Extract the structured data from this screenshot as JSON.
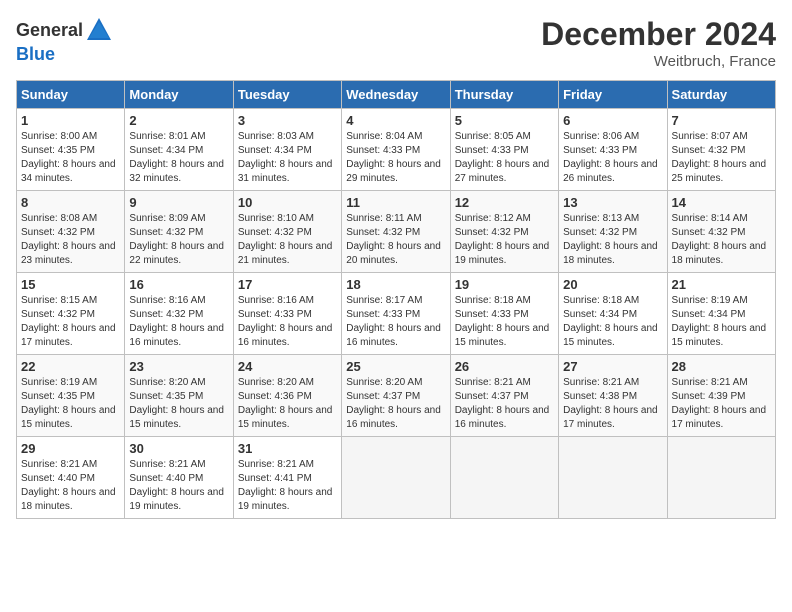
{
  "logo": {
    "general": "General",
    "blue": "Blue"
  },
  "title": "December 2024",
  "location": "Weitbruch, France",
  "days_of_week": [
    "Sunday",
    "Monday",
    "Tuesday",
    "Wednesday",
    "Thursday",
    "Friday",
    "Saturday"
  ],
  "weeks": [
    [
      {
        "day": "1",
        "sunrise": "8:00 AM",
        "sunset": "4:35 PM",
        "daylight": "8 hours and 34 minutes."
      },
      {
        "day": "2",
        "sunrise": "8:01 AM",
        "sunset": "4:34 PM",
        "daylight": "8 hours and 32 minutes."
      },
      {
        "day": "3",
        "sunrise": "8:03 AM",
        "sunset": "4:34 PM",
        "daylight": "8 hours and 31 minutes."
      },
      {
        "day": "4",
        "sunrise": "8:04 AM",
        "sunset": "4:33 PM",
        "daylight": "8 hours and 29 minutes."
      },
      {
        "day": "5",
        "sunrise": "8:05 AM",
        "sunset": "4:33 PM",
        "daylight": "8 hours and 27 minutes."
      },
      {
        "day": "6",
        "sunrise": "8:06 AM",
        "sunset": "4:33 PM",
        "daylight": "8 hours and 26 minutes."
      },
      {
        "day": "7",
        "sunrise": "8:07 AM",
        "sunset": "4:32 PM",
        "daylight": "8 hours and 25 minutes."
      }
    ],
    [
      {
        "day": "8",
        "sunrise": "8:08 AM",
        "sunset": "4:32 PM",
        "daylight": "8 hours and 23 minutes."
      },
      {
        "day": "9",
        "sunrise": "8:09 AM",
        "sunset": "4:32 PM",
        "daylight": "8 hours and 22 minutes."
      },
      {
        "day": "10",
        "sunrise": "8:10 AM",
        "sunset": "4:32 PM",
        "daylight": "8 hours and 21 minutes."
      },
      {
        "day": "11",
        "sunrise": "8:11 AM",
        "sunset": "4:32 PM",
        "daylight": "8 hours and 20 minutes."
      },
      {
        "day": "12",
        "sunrise": "8:12 AM",
        "sunset": "4:32 PM",
        "daylight": "8 hours and 19 minutes."
      },
      {
        "day": "13",
        "sunrise": "8:13 AM",
        "sunset": "4:32 PM",
        "daylight": "8 hours and 18 minutes."
      },
      {
        "day": "14",
        "sunrise": "8:14 AM",
        "sunset": "4:32 PM",
        "daylight": "8 hours and 18 minutes."
      }
    ],
    [
      {
        "day": "15",
        "sunrise": "8:15 AM",
        "sunset": "4:32 PM",
        "daylight": "8 hours and 17 minutes."
      },
      {
        "day": "16",
        "sunrise": "8:16 AM",
        "sunset": "4:32 PM",
        "daylight": "8 hours and 16 minutes."
      },
      {
        "day": "17",
        "sunrise": "8:16 AM",
        "sunset": "4:33 PM",
        "daylight": "8 hours and 16 minutes."
      },
      {
        "day": "18",
        "sunrise": "8:17 AM",
        "sunset": "4:33 PM",
        "daylight": "8 hours and 16 minutes."
      },
      {
        "day": "19",
        "sunrise": "8:18 AM",
        "sunset": "4:33 PM",
        "daylight": "8 hours and 15 minutes."
      },
      {
        "day": "20",
        "sunrise": "8:18 AM",
        "sunset": "4:34 PM",
        "daylight": "8 hours and 15 minutes."
      },
      {
        "day": "21",
        "sunrise": "8:19 AM",
        "sunset": "4:34 PM",
        "daylight": "8 hours and 15 minutes."
      }
    ],
    [
      {
        "day": "22",
        "sunrise": "8:19 AM",
        "sunset": "4:35 PM",
        "daylight": "8 hours and 15 minutes."
      },
      {
        "day": "23",
        "sunrise": "8:20 AM",
        "sunset": "4:35 PM",
        "daylight": "8 hours and 15 minutes."
      },
      {
        "day": "24",
        "sunrise": "8:20 AM",
        "sunset": "4:36 PM",
        "daylight": "8 hours and 15 minutes."
      },
      {
        "day": "25",
        "sunrise": "8:20 AM",
        "sunset": "4:37 PM",
        "daylight": "8 hours and 16 minutes."
      },
      {
        "day": "26",
        "sunrise": "8:21 AM",
        "sunset": "4:37 PM",
        "daylight": "8 hours and 16 minutes."
      },
      {
        "day": "27",
        "sunrise": "8:21 AM",
        "sunset": "4:38 PM",
        "daylight": "8 hours and 17 minutes."
      },
      {
        "day": "28",
        "sunrise": "8:21 AM",
        "sunset": "4:39 PM",
        "daylight": "8 hours and 17 minutes."
      }
    ],
    [
      {
        "day": "29",
        "sunrise": "8:21 AM",
        "sunset": "4:40 PM",
        "daylight": "8 hours and 18 minutes."
      },
      {
        "day": "30",
        "sunrise": "8:21 AM",
        "sunset": "4:40 PM",
        "daylight": "8 hours and 19 minutes."
      },
      {
        "day": "31",
        "sunrise": "8:21 AM",
        "sunset": "4:41 PM",
        "daylight": "8 hours and 19 minutes."
      },
      null,
      null,
      null,
      null
    ]
  ]
}
